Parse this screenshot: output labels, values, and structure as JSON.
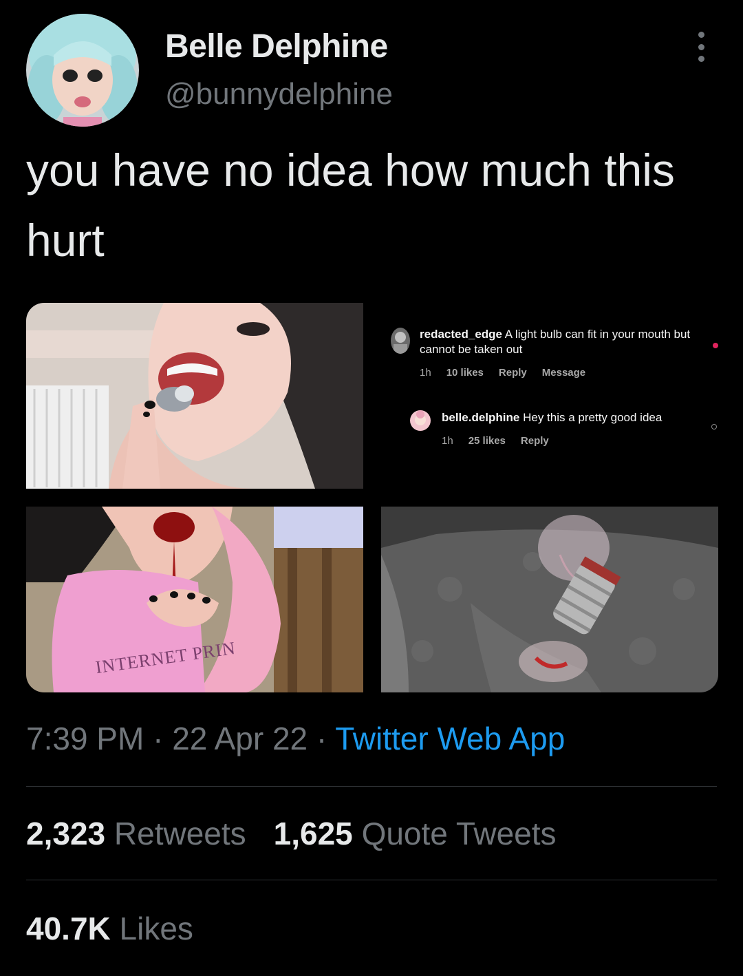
{
  "author": {
    "display_name": "Belle Delphine",
    "handle": "@bunnydelphine"
  },
  "tweet": {
    "text": "you have no idea how much this hurt"
  },
  "media": {
    "comments": [
      {
        "username": "redacted_edge",
        "text": "A light bulb can fit in your mouth but cannot be taken out",
        "time": "1h",
        "likes": "10 likes",
        "actions": [
          "Reply",
          "Message"
        ]
      },
      {
        "username": "belle.delphine",
        "text": "Hey this a pretty good idea",
        "time": "1h",
        "likes": "25 likes",
        "actions": [
          "Reply"
        ]
      }
    ],
    "shirt_text": "INTERNET PRIN"
  },
  "meta": {
    "time": "7:39 PM",
    "separator": " · ",
    "date": "22 Apr 22",
    "source": "Twitter Web App"
  },
  "stats": {
    "retweets_count": "2,323",
    "retweets_label": "Retweets",
    "quotes_count": "1,625",
    "quotes_label": "Quote Tweets",
    "likes_count": "40.7K",
    "likes_label": "Likes"
  },
  "colors": {
    "background": "#000000",
    "primary_text": "#e7e9ea",
    "secondary_text": "#71767b",
    "link": "#1d9bf0",
    "divider": "#2f3336"
  }
}
